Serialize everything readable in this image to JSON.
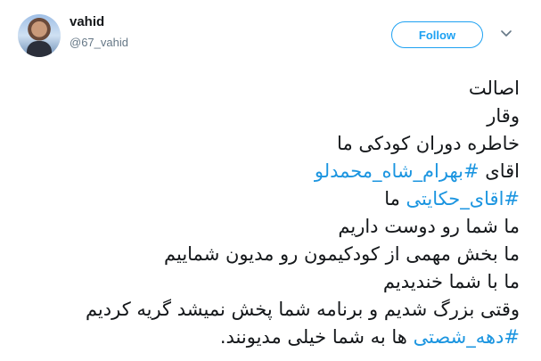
{
  "user": {
    "name": "vahid",
    "handle": "@67_vahid"
  },
  "actions": {
    "follow_label": "Follow"
  },
  "icons": {
    "menu": "chevron-down-icon"
  },
  "colors": {
    "accent": "#1da1f2",
    "hashtag": "#1b95e0",
    "text": "#14171a",
    "muted": "#657786"
  },
  "tweet": {
    "lines": [
      "اصالت",
      "وقار",
      "خاطره دوران کودکی ما",
      "اقای ",
      "#بهرام_شاه_محمدلو",
      "#اقای_حکایتی",
      " ما",
      "ما شما رو دوست داریم",
      "ما بخش مهمی از کودکیمون رو مدیون شماییم",
      "ما با شما خندیدیم",
      "وقتی بزرگ شدیم و برنامه شما پخش نمیشد گریه کردیم",
      "#دهه_شصتی",
      " ها به شما خیلی مدیونند."
    ]
  }
}
